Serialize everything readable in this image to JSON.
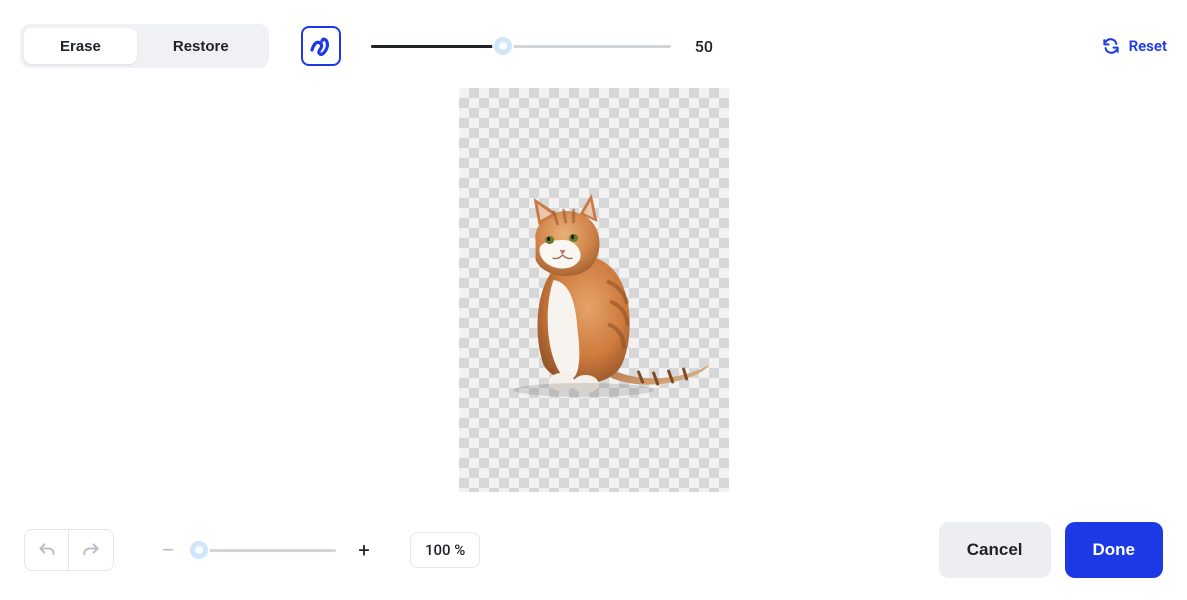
{
  "toolbar": {
    "mode": {
      "erase_label": "Erase",
      "restore_label": "Restore",
      "active": "erase"
    },
    "brush_size": {
      "value": 50,
      "display": "50",
      "min": 0,
      "max": 100
    },
    "reset_label": "Reset"
  },
  "zoom": {
    "value": 100,
    "display": "100 %",
    "minus_sign": "–",
    "plus_sign": "+",
    "slider_pos_percent": 2
  },
  "actions": {
    "cancel_label": "Cancel",
    "done_label": "Done"
  },
  "history": {
    "undo_enabled": false,
    "redo_enabled": false
  },
  "subject": {
    "description": "orange-and-white-cat"
  },
  "colors": {
    "accent": "#1d39e5",
    "text": "#1f2329",
    "muted": "#b7bac2",
    "surface": "#eceef1"
  }
}
